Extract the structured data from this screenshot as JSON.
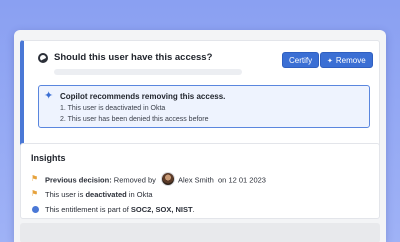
{
  "question": {
    "title": "Should this user have this access?",
    "certify_label": "Certify",
    "remove_label": "Remove"
  },
  "copilot": {
    "title": "Copilot recommends removing this access.",
    "reasons": [
      "1. This user is deactivated in Okta",
      "2. This user has been denied this access before"
    ]
  },
  "insights": {
    "title": "Insights",
    "previous_decision": {
      "label": "Previous decision:",
      "text": "Removed by",
      "user": "Alex Smith",
      "date": "on 12 01 2023"
    },
    "status": {
      "prefix": "This user is",
      "state": "deactivated",
      "suffix": "in Okta"
    },
    "entitlement": {
      "prefix": "This entitlement is part of",
      "frameworks": "SOC2, SOX, NIST",
      "suffix": "."
    }
  },
  "colors": {
    "accent": "#3b6fd4",
    "flag": "#e6a23c",
    "background": "#8aa0f2"
  },
  "icons": [
    "question-icon",
    "copilot-sparkle-icon",
    "wand-icon",
    "flag-icon",
    "info-dot-icon",
    "avatar"
  ]
}
